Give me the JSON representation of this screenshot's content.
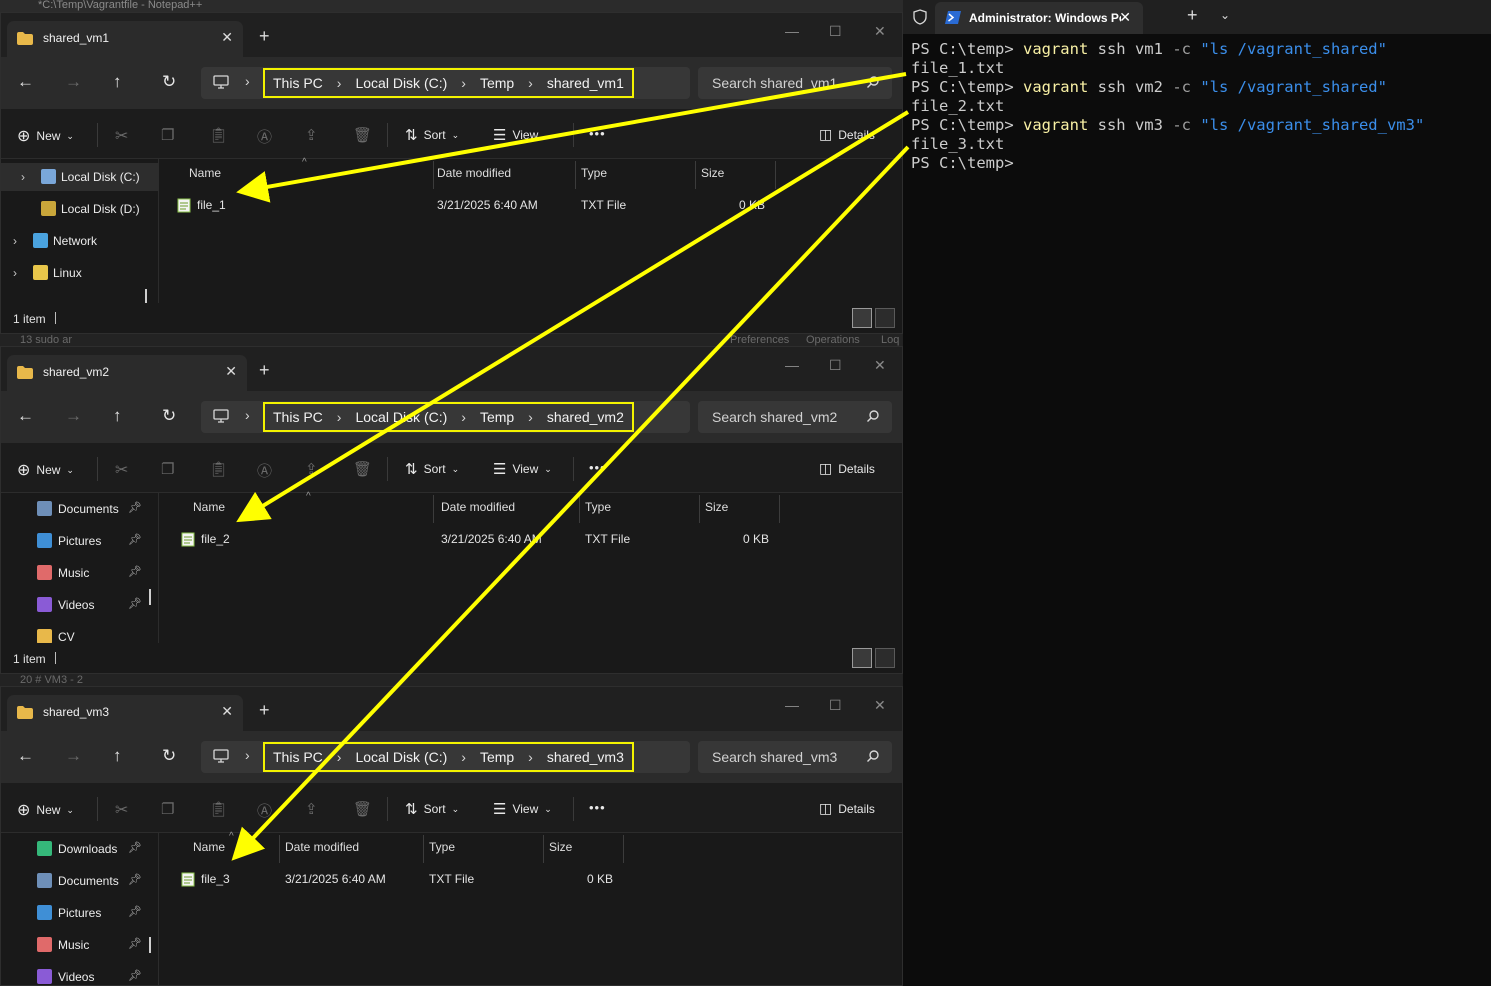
{
  "background": {
    "notepad_title": "*C:\\Temp\\Vagrantfile - Notepad++",
    "gap1_left": "13      sudo  ar",
    "gap1_right": [
      "Preferences",
      "Operations",
      "Loq"
    ],
    "gap2_left": "20      # VM3 - 2"
  },
  "explorers": [
    {
      "tab_title": "shared_vm1",
      "breadcrumb": [
        "This PC",
        "Local Disk (C:)",
        "Temp",
        "shared_vm1"
      ],
      "search_placeholder": "Search shared_vm1",
      "commands": {
        "new": "New",
        "sort": "Sort",
        "view": "View",
        "details": "Details",
        "more": "•••"
      },
      "nav_items": [
        {
          "label": "Local Disk (C:)",
          "icon": "drive-c-icon"
        },
        {
          "label": "Local Disk (D:)",
          "icon": "drive-d-icon"
        },
        {
          "label": "Network",
          "icon": "network-icon"
        },
        {
          "label": "Linux",
          "icon": "linux-icon"
        }
      ],
      "columns": [
        "Name",
        "Date modified",
        "Type",
        "Size"
      ],
      "files": [
        {
          "name": "file_1",
          "date": "3/21/2025 6:40 AM",
          "type": "TXT File",
          "size": "0 KB"
        }
      ],
      "status": "1 item"
    },
    {
      "tab_title": "shared_vm2",
      "breadcrumb": [
        "This PC",
        "Local Disk (C:)",
        "Temp",
        "shared_vm2"
      ],
      "search_placeholder": "Search shared_vm2",
      "commands": {
        "new": "New",
        "sort": "Sort",
        "view": "View",
        "details": "Details",
        "more": "•••"
      },
      "nav_items": [
        {
          "label": "Documents",
          "icon": "documents-icon"
        },
        {
          "label": "Pictures",
          "icon": "pictures-icon"
        },
        {
          "label": "Music",
          "icon": "music-icon"
        },
        {
          "label": "Videos",
          "icon": "videos-icon"
        },
        {
          "label": "CV",
          "icon": "folder-icon"
        }
      ],
      "columns": [
        "Name",
        "Date modified",
        "Type",
        "Size"
      ],
      "files": [
        {
          "name": "file_2",
          "date": "3/21/2025 6:40 AM",
          "type": "TXT File",
          "size": "0 KB"
        }
      ],
      "status": "1 item"
    },
    {
      "tab_title": "shared_vm3",
      "breadcrumb": [
        "This PC",
        "Local Disk (C:)",
        "Temp",
        "shared_vm3"
      ],
      "search_placeholder": "Search shared_vm3",
      "commands": {
        "new": "New",
        "sort": "Sort",
        "view": "View",
        "details": "Details",
        "more": "•••"
      },
      "nav_items": [
        {
          "label": "Downloads",
          "icon": "downloads-icon"
        },
        {
          "label": "Documents",
          "icon": "documents-icon"
        },
        {
          "label": "Pictures",
          "icon": "pictures-icon"
        },
        {
          "label": "Music",
          "icon": "music-icon"
        },
        {
          "label": "Videos",
          "icon": "videos-icon"
        }
      ],
      "columns": [
        "Name",
        "Date modified",
        "Type",
        "Size"
      ],
      "files": [
        {
          "name": "file_3",
          "date": "3/21/2025 6:40 AM",
          "type": "TXT File",
          "size": "0 KB"
        }
      ],
      "status": ""
    }
  ],
  "terminal": {
    "tab_title": "Administrator: Windows PowerShell",
    "lines": [
      {
        "prompt": "PS C:\\temp> ",
        "cmd": "vagrant",
        "args": " ssh vm1 ",
        "flag": "-c",
        "str": " \"ls /vagrant_shared\""
      },
      {
        "output": "file_1.txt"
      },
      {
        "prompt": "PS C:\\temp> ",
        "cmd": "vagrant",
        "args": " ssh vm2 ",
        "flag": "-c",
        "str": " \"ls /vagrant_shared\""
      },
      {
        "output": "file_2.txt"
      },
      {
        "prompt": "PS C:\\temp> ",
        "cmd": "vagrant",
        "args": " ssh vm3 ",
        "flag": "-c",
        "str": " \"ls /vagrant_shared_vm3\""
      },
      {
        "output": "file_3.txt"
      },
      {
        "prompt": "PS C:\\temp> "
      }
    ]
  },
  "annotation_color": "#ffff00",
  "colors": {
    "highlight_box": "#f3f300",
    "terminal_string": "#3b8eea",
    "terminal_keyword": "#f9f1a5"
  }
}
